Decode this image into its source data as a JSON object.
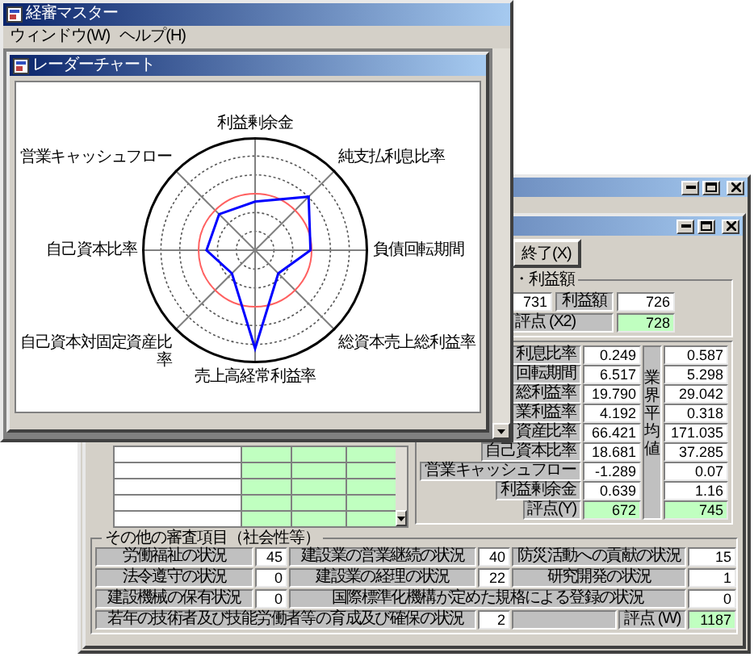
{
  "chart_window": {
    "title": "経審マスター",
    "menu": [
      "ウィンドウ(W)",
      "ヘルプ(H)"
    ],
    "child_title": "レーダーチャート",
    "axis_labels": [
      "利益剰余金",
      "営業キャッシュフロー",
      "純支払利息比率",
      "自己資本比率",
      "負債回転期間",
      "自己資本対固定資産比率",
      "総資本売上総利益率",
      "売上高経常利益率"
    ]
  },
  "main_window": {
    "exit_button": "終了(X)",
    "profit_group": {
      "legend": "・利益額",
      "value_1": "731",
      "label": "利益額",
      "value_2": "726",
      "score_label": "評点 (X2)",
      "score": "728"
    },
    "financial_group": {
      "average_label": "業界平均値",
      "rows": [
        {
          "kind": "ratio",
          "label": "利息比率",
          "value": "0.249",
          "average": "0.587"
        },
        {
          "kind": "ratio",
          "label": "回転期間",
          "value": "6.517",
          "average": "5.298"
        },
        {
          "kind": "ratio",
          "label": "総利益率",
          "value": "19.790",
          "average": "29.042"
        },
        {
          "kind": "ratio",
          "label": "業利益率",
          "value": "4.192",
          "average": "0.318"
        },
        {
          "kind": "ratio",
          "label": "資産比率",
          "value": "66.421",
          "average": "171.035"
        },
        {
          "kind": "ratio",
          "label": "自己資本比率",
          "value": "18.681",
          "average": "37.285"
        },
        {
          "kind": "ratio",
          "label": "営業キャッシュフロー",
          "value": "-1.289",
          "average": "0.07"
        },
        {
          "kind": "ratio",
          "label": "利益剰余金",
          "value": "0.639",
          "average": "1.16"
        },
        {
          "kind": "score",
          "label": "評点(Y)",
          "value": "672",
          "average": "745"
        }
      ]
    },
    "other_group": {
      "legend": "その他の審査項目（社会性等）",
      "rows": [
        [
          {
            "label": "労働福祉の状況",
            "value": "45"
          },
          {
            "label": "建設業の営業継続の状況",
            "value": "40"
          },
          {
            "label": "防災活動への貢献の状況",
            "value": "15"
          }
        ],
        [
          {
            "label": "法令遵守の状況",
            "value": "0"
          },
          {
            "label": "建設業の経理の状況",
            "value": "22"
          },
          {
            "label": "研究開発の状況",
            "value": "1"
          }
        ],
        [
          {
            "label": "建設機械の保有状況",
            "value": "0"
          },
          {
            "label": "国際標準化機構が定めた規格による登録の状況",
            "value": "0"
          }
        ],
        [
          {
            "label": "若年の技術者及び技能労働者等の育成及び確保の状況",
            "value": "2"
          }
        ]
      ],
      "score_label": "評点 (W)",
      "score": "1187"
    }
  }
}
